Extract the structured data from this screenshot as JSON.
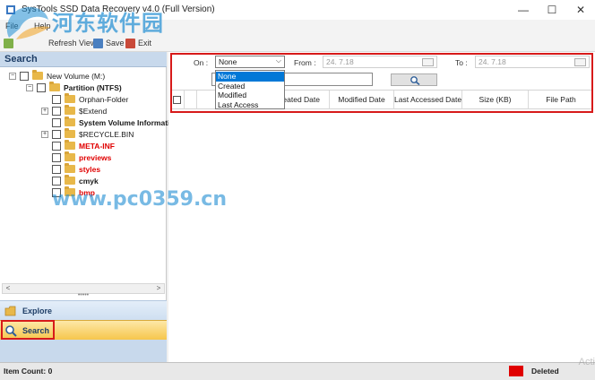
{
  "window": {
    "title": "SysTools SSD Data Recovery v4.0 (Full Version)",
    "minimize_glyph": "—",
    "maximize_glyph": "☐",
    "close_glyph": "✕"
  },
  "menu": {
    "items": [
      "File",
      "Help"
    ]
  },
  "toolbar": {
    "refresh_label": "Refresh View",
    "save_label": "Save",
    "exit_label": "Exit"
  },
  "watermark": {
    "cn_text": "河东软件园",
    "url_text": "www.pc0359.cn",
    "activate_text": "Acti"
  },
  "left_pane": {
    "header": "Search",
    "tree": {
      "root": "New Volume (M:)",
      "partition": "Partition (NTFS)",
      "items": [
        {
          "label": "Orphan-Folder",
          "style": "normal",
          "expandable": false
        },
        {
          "label": "$Extend",
          "style": "normal",
          "expandable": true
        },
        {
          "label": "System Volume Informati",
          "style": "bold",
          "expandable": false
        },
        {
          "label": "$RECYCLE.BIN",
          "style": "normal",
          "expandable": true
        },
        {
          "label": "META-INF",
          "style": "red",
          "expandable": false
        },
        {
          "label": "previews",
          "style": "red",
          "expandable": false
        },
        {
          "label": "styles",
          "style": "red",
          "expandable": false
        },
        {
          "label": "cmyk",
          "style": "bold",
          "expandable": false
        },
        {
          "label": "bmp",
          "style": "red",
          "expandable": false
        }
      ]
    },
    "scroll_left": "<",
    "scroll_right": ">",
    "splitter_dots": "•••••",
    "nav": {
      "explore_label": "Explore",
      "search_label": "Search"
    }
  },
  "filter": {
    "on_label": "On :",
    "on_value": "None",
    "from_label": "From :",
    "from_value": "24. 7.18",
    "to_label": "To :",
    "to_value": "24. 7.18",
    "search_value": "",
    "dropdown_options": [
      "None",
      "Created",
      "Modified",
      "Last Access"
    ],
    "selected_option": "None"
  },
  "table": {
    "columns": [
      "Created Date",
      "Modified Date",
      "Last Accessed Date",
      "Size (KB)",
      "File Path"
    ]
  },
  "status": {
    "item_count": "Item Count: 0",
    "deleted_label": "Deleted"
  },
  "colors": {
    "deleted_swatch": "#e00000",
    "highlight_box": "#d71a1a",
    "selected_option": "#0078d7"
  }
}
